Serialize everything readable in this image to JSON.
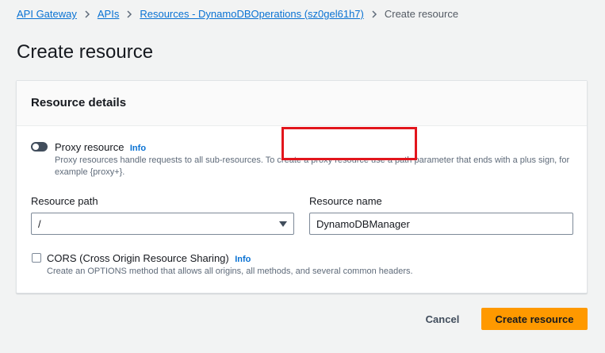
{
  "breadcrumb": {
    "items": [
      "API Gateway",
      "APIs",
      "Resources - DynamoDBOperations (sz0gel61h7)"
    ],
    "current": "Create resource"
  },
  "page_title": "Create resource",
  "panel": {
    "title": "Resource details",
    "proxy": {
      "label": "Proxy resource",
      "info": "Info",
      "description": "Proxy resources handle requests to all sub-resources. To create a proxy resource use a path parameter that ends with a plus sign, for example {proxy+}.",
      "enabled": false
    },
    "resource_path": {
      "label": "Resource path",
      "value": "/"
    },
    "resource_name": {
      "label": "Resource name",
      "value": "DynamoDBManager"
    },
    "cors": {
      "label": "CORS (Cross Origin Resource Sharing)",
      "info": "Info",
      "description": "Create an OPTIONS method that allows all origins, all methods, and several common headers.",
      "checked": false
    }
  },
  "actions": {
    "cancel": "Cancel",
    "submit": "Create resource"
  },
  "colors": {
    "primary": "#ff9900",
    "link": "#0972d3",
    "highlight": "#e2151c"
  }
}
